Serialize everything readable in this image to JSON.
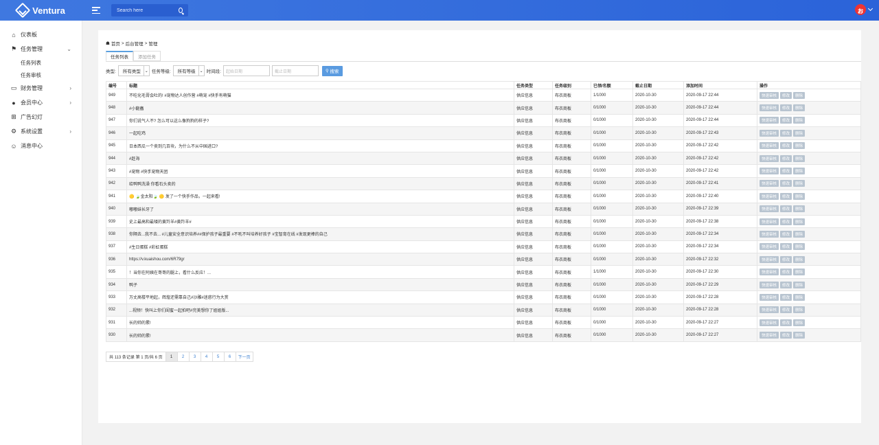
{
  "app": {
    "name": "Ventura"
  },
  "search": {
    "placeholder": "Search here"
  },
  "user": {
    "avatar_glyph": "ぉ"
  },
  "sidebar": {
    "items": [
      {
        "label": "仪表板",
        "icon": "home-icon"
      },
      {
        "label": "任务管理",
        "icon": "flag-icon",
        "expanded": true,
        "children": [
          "任务列表",
          "任务审核"
        ]
      },
      {
        "label": "财务管理",
        "icon": "wallet-icon"
      },
      {
        "label": "会员中心",
        "icon": "user-icon"
      },
      {
        "label": "广告幻灯",
        "icon": "grid-icon"
      },
      {
        "label": "系统设置",
        "icon": "gear-icon"
      },
      {
        "label": "消息中心",
        "icon": "chat-icon"
      }
    ]
  },
  "breadcrumb": {
    "home": "首页",
    "sep": ">",
    "level2": "后台管理",
    "level3": "管理"
  },
  "tabs": [
    "任务列表",
    "添加任务"
  ],
  "filters": {
    "type_label": "类型:",
    "type_value": "所有类型",
    "level_label": "任务等级:",
    "level_value": "所有等级",
    "time_label": "时间段:",
    "start_placeholder": "起始日期",
    "end_placeholder": "截止日期",
    "search_button": "搜索"
  },
  "table": {
    "headers": [
      "编号",
      "标题",
      "任务类型",
      "任务级别",
      "已领/名额",
      "截止日期",
      "添加时间",
      "操作"
    ],
    "op_labels": [
      "快速审核",
      "修改",
      "删除"
    ],
    "rows": [
      [
        "949",
        "不吃化毛膏会吐的! #宠物达人创作营 #萌宠 #快手有萌猫",
        "供应信息",
        "布衣商板",
        "1/1000",
        "2020-10-30",
        "2020-09-17 22:44"
      ],
      [
        "948",
        "#小龍蟲",
        "供应信息",
        "布衣商板",
        "0/1000",
        "2020-10-30",
        "2020-09-17 22:44"
      ],
      [
        "947",
        "你们说气人不? 怎么可以这么像狗狗的样子?",
        "供应信息",
        "布衣商板",
        "0/1000",
        "2020-10-30",
        "2020-09-17 22:44"
      ],
      [
        "946",
        "一起吃鸡",
        "供应信息",
        "布衣商板",
        "0/1000",
        "2020-10-30",
        "2020-09-17 22:43"
      ],
      [
        "945",
        "日本西瓜一个卖到几百块，为什么不从中国进口?",
        "供应信息",
        "布衣商板",
        "0/1000",
        "2020-10-30",
        "2020-09-17 22:42"
      ],
      [
        "944",
        "#赶海",
        "供应信息",
        "布衣商板",
        "0/1000",
        "2020-10-30",
        "2020-09-17 22:42"
      ],
      [
        "943",
        "#宠物 #快手宠物天团",
        "供应信息",
        "布衣商板",
        "0/1000",
        "2020-10-30",
        "2020-09-17 22:42"
      ],
      [
        "942",
        "给鸭鸭洗澡 你看石头卖的",
        "供应信息",
        "布衣商板",
        "0/1000",
        "2020-10-30",
        "2020-09-17 22:41"
      ],
      [
        "941",
        "🟡 🍃金太阳🍃 🟡 发了一个快手作品，一起来看!",
        "供应信息",
        "布衣商板",
        "0/1000",
        "2020-10-30",
        "2020-09-17 22:40"
      ],
      [
        "940",
        "嘟嘟妹长牙了",
        "供应信息",
        "布衣商板",
        "0/1000",
        "2020-10-30",
        "2020-09-17 22:39"
      ],
      [
        "939",
        "史上最高和最矮的黄羚羊#黄羚羊#",
        "供应信息",
        "布衣商板",
        "0/1000",
        "2020-10-30",
        "2020-09-17 22:38"
      ],
      [
        "938",
        "你隔去...我不去... #儿童安全意识培养##保护孩子最重要 #不吼不叫培养好孩子 #宝智育在线 #发现更棒的自己",
        "供应信息",
        "布衣商板",
        "0/1000",
        "2020-10-30",
        "2020-09-17 22:34"
      ],
      [
        "937",
        "#生日蛋糕 #彩虹蛋糕",
        "供应信息",
        "布衣商板",
        "0/1000",
        "2020-10-30",
        "2020-09-17 22:34"
      ],
      [
        "936",
        "https://v.kuaishou.com/6R79gr",
        "供应信息",
        "布衣商板",
        "0/1000",
        "2020-10-30",
        "2020-09-17 22:32"
      ],
      [
        "935",
        "！当你在阿姨在哥哥的腿上，看什么反应！...",
        "供应信息",
        "布衣商板",
        "1/1000",
        "2020-10-30",
        "2020-09-17 22:30"
      ],
      [
        "934",
        "鸭子",
        "供应信息",
        "布衣商板",
        "0/1000",
        "2020-10-30",
        "2020-09-17 22:29"
      ],
      [
        "933",
        "万丈高楼平地起，辉煌还需靠自己#沙雕#迷惑行为大赏",
        "供应信息",
        "布衣商板",
        "0/1000",
        "2020-10-30",
        "2020-09-17 22:28"
      ],
      [
        "932",
        "...视频！快叫上你们闺蜜一起拍吧#完美想你了姐姐版...",
        "供应信息",
        "布衣商板",
        "0/1000",
        "2020-10-30",
        "2020-09-17 22:28"
      ],
      [
        "931",
        "长的帅的累!",
        "供应信息",
        "布衣商板",
        "0/1000",
        "2020-10-30",
        "2020-09-17 22:27"
      ],
      [
        "930",
        "长的帅的累!",
        "供应信息",
        "布衣商板",
        "0/1000",
        "2020-10-30",
        "2020-09-17 22:27"
      ]
    ]
  },
  "pager": {
    "info": "共 113 条记录 第 1 页/共 6 页",
    "pages": [
      "1",
      "2",
      "3",
      "4",
      "5",
      "6"
    ],
    "current": "1",
    "next": "下一页"
  }
}
